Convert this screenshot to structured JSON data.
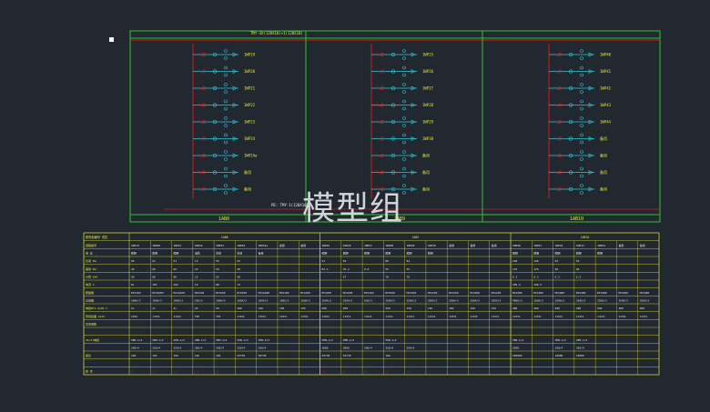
{
  "watermark": "模型组",
  "bus": {
    "title": "TMY-3X(120X10)+1(120X10)",
    "neutral_label": "PE: TMY-1(120X10)",
    "sections": [
      {
        "name": "1AB8",
        "circuits": [
          "1WP19",
          "1WP20",
          "1WP21",
          "1WP22",
          "1WP23",
          "1WP24",
          "1WP24a",
          "备用",
          "备用"
        ]
      },
      {
        "name": "1AB9",
        "circuits": [
          "1WP25",
          "1WP26",
          "1WP27",
          "1WP28",
          "1WP29",
          "1WP30",
          "备用",
          "备用",
          "备用"
        ]
      },
      {
        "name": "1AB10",
        "circuits": [
          "1WP40",
          "1WP41",
          "1WP42",
          "1WP43",
          "1WP44",
          "备用",
          "备用",
          "备用",
          "备用"
        ]
      }
    ]
  },
  "table": {
    "header_left": "配电柜编号 低压",
    "group_labels": [
      "1AB8",
      "1AB9",
      "1AB10"
    ],
    "row_labels": [
      "回路编号",
      "用 途",
      "负荷 KW",
      "需用 KW",
      "计算 KVA",
      "电流 A",
      "断路器",
      "互感器",
      "电缆BYJ-4x95-Y",
      "导线截面 4x25",
      "功率因数",
      "",
      "2A/37电缆",
      "",
      "备注",
      "",
      "柜 号"
    ],
    "columns": [
      [
        "1WP19",
        "照明",
        "66",
        "40",
        "58",
        "81",
        "MCS160",
        "160A/3",
        "2x",
        "125S",
        "",
        "",
        "VEN-1/2",
        "250/4",
        "10A",
        "",
        "25"
      ],
      [
        "1WP20",
        "照明",
        "61",
        "60",
        "80",
        "102",
        "MCS160H",
        "160A/3",
        "2x",
        "1JSYL",
        "",
        "",
        "VEN-1/2",
        "250/4",
        "10A",
        "",
        "23"
      ],
      [
        "1WP21",
        "照明",
        "61",
        "60",
        "80",
        "102",
        "MCS160H",
        "160A/3",
        "2x",
        "1JSYL",
        "",
        "",
        "VEN-1/2",
        "250/4",
        "10A",
        "",
        "23"
      ],
      [
        "1WP22",
        "消防",
        "13",
        "10",
        "13",
        "19",
        "MCS160",
        "63A/3",
        "25",
        "TPS",
        "",
        "",
        "VEN-1/2",
        "250/4",
        "10A",
        "",
        "25"
      ],
      [
        "1WP23",
        "空调",
        "55",
        "50",
        "65",
        "88",
        "MCS250",
        "160A/3",
        "50",
        "TPS",
        "",
        "",
        "VEN-1/2",
        "250/4",
        "10A",
        "",
        "25"
      ],
      [
        "1WP24",
        "空调",
        "55",
        "40",
        "58",
        "72",
        "MCS250",
        "160A/3",
        "200",
        "1JSYL",
        "",
        "",
        "VEN-1/2",
        "250/4",
        "52730",
        "",
        ""
      ],
      [
        "1WP24a",
        "备用",
        "",
        "",
        "",
        "",
        "MCS160H",
        "160A/3",
        "150",
        "1JSYL",
        "",
        "",
        "VEN-1/2",
        "250/4",
        "50730",
        "",
        ""
      ],
      [
        "备用",
        "",
        "",
        "",
        "",
        "",
        "MCS160",
        "160A/3",
        "150",
        "1JSYL",
        "",
        "",
        "",
        "",
        "",
        "",
        ""
      ],
      [
        "备用",
        "",
        "",
        "",
        "",
        "",
        "MCS160",
        "160A/3",
        "150",
        "1JSYL",
        "",
        "",
        "",
        "",
        "",
        "",
        ""
      ],
      [
        "1WP25",
        "照明",
        "91",
        "82.4",
        "",
        "",
        "MCS250",
        "250A/3",
        "200",
        "1JSYL",
        "",
        "",
        "VEN-1/2",
        "2000",
        "52730",
        "",
        "25"
      ],
      [
        "1WP26",
        "照明",
        "81",
        "35.2",
        "47",
        "",
        "MCS250",
        "250A/3",
        "200",
        "1JSYL",
        "",
        "",
        "VEN-1/2",
        "2000",
        "52730",
        "",
        "25"
      ],
      [
        "1WP27",
        "照明",
        "",
        "0.8",
        "",
        "",
        "MCS160",
        "63A/3",
        "",
        "1JSYL",
        "",
        "",
        "",
        "250/4",
        "",
        "",
        "25"
      ],
      [
        "1WP28",
        "照明",
        "80",
        "55",
        "78",
        "",
        "MCS250",
        "250A/3",
        "250",
        "1JSYL",
        "",
        "",
        "VEN-1/2",
        "250/4",
        "10A",
        "",
        "25"
      ],
      [
        "1WP29",
        "照明",
        "81",
        "55",
        "78",
        "",
        "MCS250",
        "250A/3",
        "150",
        "1JSYL",
        "",
        "",
        "",
        "250/4",
        "",
        "",
        "25"
      ],
      [
        "1WP30",
        "照明",
        "",
        "",
        "",
        "",
        "MCS250",
        "250A/3",
        "150",
        "1JSYL",
        "",
        "",
        "",
        "",
        "",
        "",
        ""
      ],
      [
        "备用",
        "",
        "",
        "",
        "",
        "",
        "MCS250",
        "250A/3",
        "150",
        "1JSYL",
        "",
        "",
        "",
        "",
        "",
        "",
        ""
      ],
      [
        "备用",
        "",
        "",
        "",
        "",
        "",
        "MCS250",
        "250A/3",
        "150",
        "1JSYL",
        "",
        "",
        "",
        "",
        "",
        "",
        ""
      ],
      [
        "备用",
        "",
        "",
        "",
        "",
        "",
        "MCS250",
        "250A/3",
        "150",
        "1JSYL",
        "",
        "",
        "",
        "",
        "",
        "",
        ""
      ],
      [
        "1WP40",
        "照明",
        "128",
        "176",
        "6.3",
        "336.2",
        "MCS400",
        "400A/3",
        "400",
        "1JSYL",
        "",
        "",
        "VEN-1/2",
        "2500",
        "250000",
        "",
        ""
      ],
      [
        "1WP41",
        "照明",
        "128",
        "176",
        "6.3",
        "199.5",
        "MCS400",
        "250A/3",
        "250",
        "1JSYL",
        "",
        "",
        "",
        "",
        "",
        "",
        ""
      ],
      [
        "1WP42",
        "照明",
        "63",
        "66",
        "6.3",
        "",
        "MCS400",
        "250A/3",
        "400",
        "1JSYL",
        "",
        "",
        "VEN-1/2",
        "250/4",
        "10000",
        "",
        ""
      ],
      [
        "1WP43",
        "照明",
        "63",
        "66",
        "6.3",
        "",
        "MCS400",
        "250A/3",
        "400",
        "1JSYL",
        "",
        "",
        "VEN-1/2",
        "250/4",
        "10000",
        "",
        ""
      ],
      [
        "1WP44",
        "照明",
        "",
        "",
        "",
        "",
        "MCS400",
        "250A/3",
        "250",
        "1JSYL",
        "",
        "",
        "",
        "",
        "",
        "",
        ""
      ],
      [
        "备用",
        "",
        "",
        "",
        "",
        "",
        "MCS400",
        "250A/3",
        "400",
        "1JSYL",
        "",
        "",
        "",
        "",
        "",
        "",
        ""
      ],
      [
        "备用",
        "",
        "",
        "",
        "",
        "",
        "MCS400",
        "250A/3",
        "400",
        "1JSYL",
        "",
        "",
        "",
        "",
        "",
        "",
        ""
      ]
    ]
  },
  "colors": {
    "background": "#212830",
    "green": "#2fc42f",
    "red": "#d81818",
    "yellow": "#e8e838",
    "cyan": "#2ec8d8",
    "white": "#e8e8e8"
  }
}
